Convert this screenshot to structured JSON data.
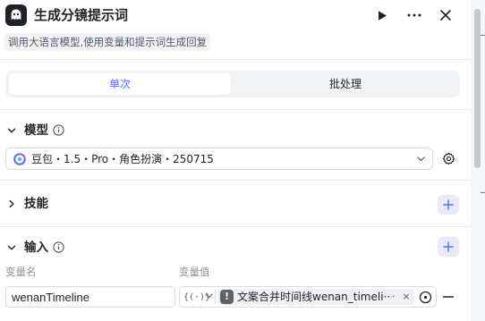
{
  "header": {
    "title": "生成分镜提示词",
    "description": "调用大语言模型,使用变量和提示词生成回复",
    "logo_icon": "ghost-logo-icon",
    "run_icon": "play-icon",
    "more_icon": "more-horizontal-icon",
    "close_icon": "close-icon"
  },
  "tabs": [
    {
      "label": "单次",
      "active": true
    },
    {
      "label": "批处理",
      "active": false
    }
  ],
  "model_section": {
    "title": "模型",
    "selected_model": "豆包・1.5・Pro・角色扮演・250715",
    "settings_icon": "gear-icon"
  },
  "skills_section": {
    "title": "技能"
  },
  "input_section": {
    "title": "输入",
    "columns": {
      "name": "变量名",
      "value": "变量值"
    },
    "rows": [
      {
        "name": "wenanTimeline",
        "type_label": "{(·)}",
        "reference": "文案合并时间线wenan_timeli···",
        "reference_suffix": "·",
        "remove_label": "×"
      }
    ]
  },
  "colors": {
    "accent": "#4f6ef7",
    "add_button_bg": "#e8eafc",
    "warning_badge": "#5d6168"
  }
}
